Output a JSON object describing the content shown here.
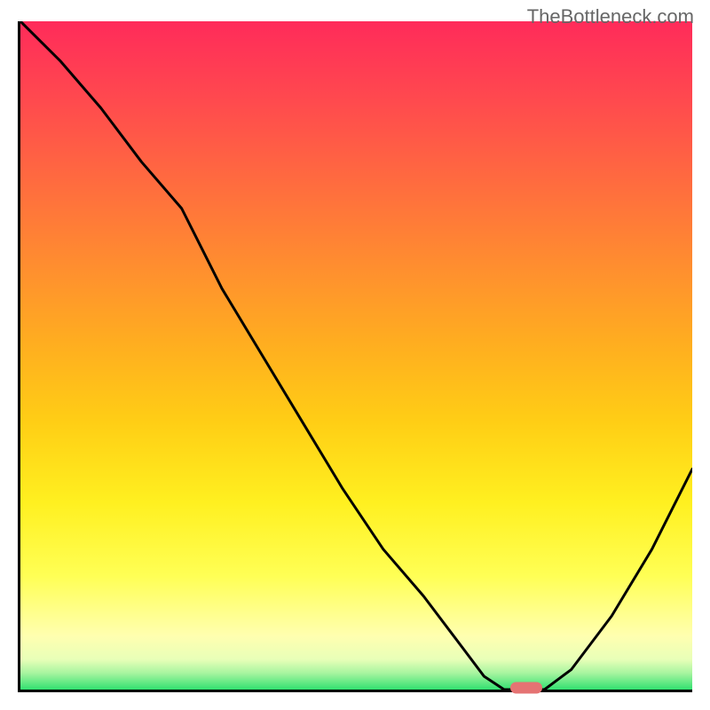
{
  "watermark": "TheBottleneck.com",
  "colors": {
    "gradient_top": "#ff2b5a",
    "gradient_bottom": "#32e070",
    "axis": "#000000",
    "curve": "#000000",
    "marker": "#e57373"
  },
  "chart_data": {
    "type": "line",
    "title": "",
    "xlabel": "",
    "ylabel": "",
    "xlim": [
      0,
      100
    ],
    "ylim": [
      0,
      100
    ],
    "series": [
      {
        "name": "bottleneck-curve",
        "x": [
          0,
          6,
          12,
          18,
          24,
          30,
          36,
          42,
          48,
          54,
          60,
          66,
          69,
          72,
          75,
          78,
          82,
          88,
          94,
          100
        ],
        "values": [
          100,
          94,
          87,
          79,
          72,
          60,
          50,
          40,
          30,
          21,
          14,
          6,
          2,
          0,
          0,
          0,
          3,
          11,
          21,
          33
        ]
      }
    ],
    "annotations": [
      {
        "name": "optimal-marker",
        "x": 75,
        "y": 0
      }
    ],
    "grid": false,
    "legend": false
  }
}
